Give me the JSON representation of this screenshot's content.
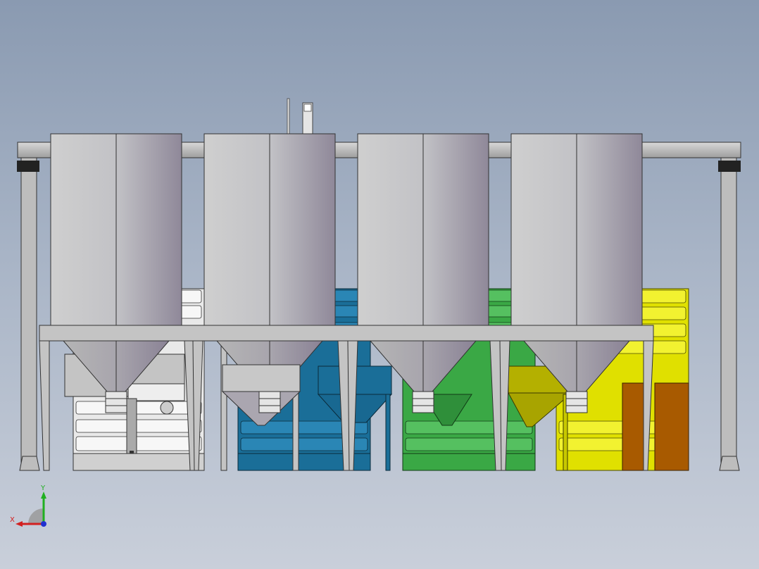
{
  "viewport": {
    "background_top": "#8a9ab1",
    "background_bottom": "#c9cfda"
  },
  "scene": {
    "description_colors": {
      "silo_light": "#d9d9d9",
      "silo_dark": "#8c8898",
      "frame": "#c8c8c8",
      "white_stack": "#f2f2f2",
      "blue_stack": "#1a6e98",
      "green_stack": "#3aa845",
      "yellow_stack": "#e0e000",
      "orange_bin": "#a85a00"
    }
  },
  "triad": {
    "x_label": "X",
    "y_label": "Y",
    "x_color": "#d22020",
    "y_color": "#20b020",
    "z_color": "#2030d0"
  }
}
